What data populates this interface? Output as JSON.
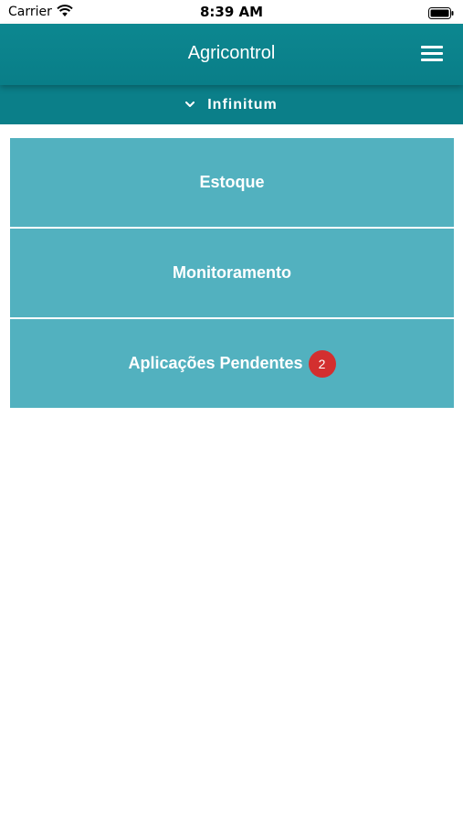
{
  "status_bar": {
    "carrier": "Carrier",
    "time": "8:39 AM",
    "icons": [
      "wifi-icon",
      "battery-icon"
    ]
  },
  "header": {
    "title": "Agricontrol",
    "menu_icon": "hamburger-menu-icon"
  },
  "farm_selector": {
    "icon": "chevron-down-icon",
    "label": "Infinitum"
  },
  "menu": {
    "items": [
      {
        "label": "Estoque"
      },
      {
        "label": "Monitoramento"
      },
      {
        "label": "Aplicações Pendentes",
        "badge": "2"
      }
    ]
  },
  "colors": {
    "header_bg": "#0d8790",
    "selector_bg": "#0b7f89",
    "tile_bg": "#52b1bf",
    "badge_bg": "#d32f2f"
  }
}
